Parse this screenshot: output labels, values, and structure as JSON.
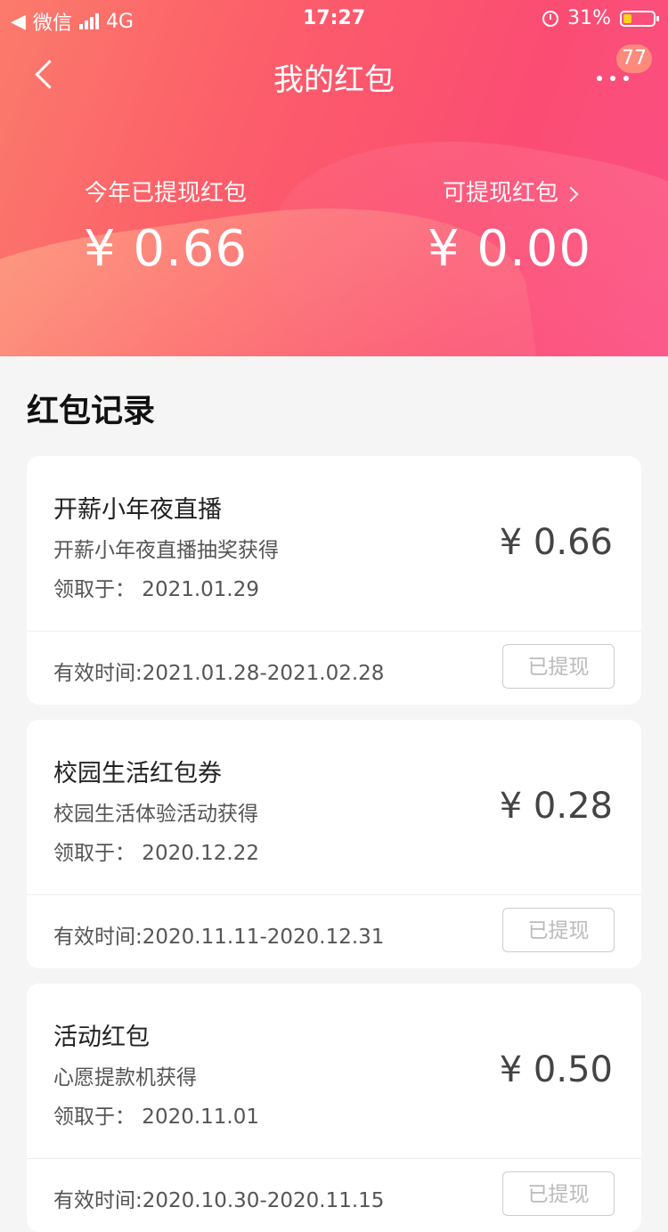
{
  "status_bar": {
    "carrier": "微信",
    "network": "4G",
    "time": "17:27",
    "battery": "31%"
  },
  "header": {
    "title": "我的红包",
    "badge_count": "77",
    "stats": [
      {
        "label": "今年已提现红包",
        "value": "¥ 0.66"
      },
      {
        "label": "可提现红包",
        "value": "¥ 0.00"
      }
    ]
  },
  "section_title": "红包记录",
  "records": [
    {
      "name": "开薪小年夜直播",
      "desc": "开薪小年夜直播抽奖获得",
      "date": "领取于： 2021.01.29",
      "amount": "¥ 0.66",
      "valid": "有效时间:2021.01.28-2021.02.28",
      "status": "已提现"
    },
    {
      "name": "校园生活红包券",
      "desc": "校园生活体验活动获得",
      "date": "领取于： 2020.12.22",
      "amount": "¥ 0.28",
      "valid": "有效时间:2020.11.11-2020.12.31",
      "status": "已提现"
    },
    {
      "name": "活动红包",
      "desc": "心愿提款机获得",
      "date": "领取于： 2020.11.01",
      "amount": "¥ 0.50",
      "valid": "有效时间:2020.10.30-2020.11.15",
      "status": "已提现"
    }
  ],
  "colors": {
    "accent": "#fc5e6a",
    "accent2": "#fb4f86"
  }
}
